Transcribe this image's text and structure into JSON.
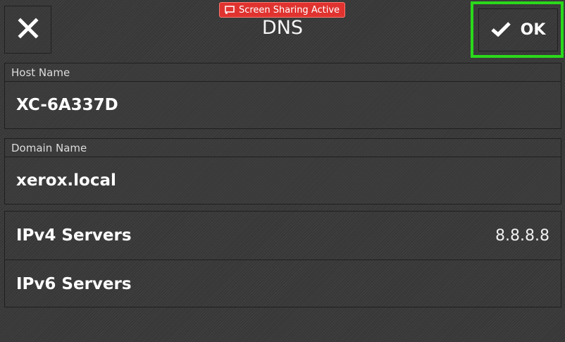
{
  "header": {
    "title": "DNS",
    "close_icon": "close-icon",
    "ok_label": "OK",
    "ok_icon": "checkmark-icon",
    "highlight_color": "#2bd81b"
  },
  "sharing_badge": {
    "label": "Screen Sharing Active",
    "icon": "screen-share-icon",
    "color": "#e0332f"
  },
  "fields": {
    "host_name": {
      "label": "Host Name",
      "value": "XC-6A337D"
    },
    "domain_name": {
      "label": "Domain Name",
      "value": "xerox.local"
    }
  },
  "servers": {
    "ipv4": {
      "label": "IPv4 Servers",
      "value": "8.8.8.8"
    },
    "ipv6": {
      "label": "IPv6 Servers",
      "value": ""
    }
  }
}
